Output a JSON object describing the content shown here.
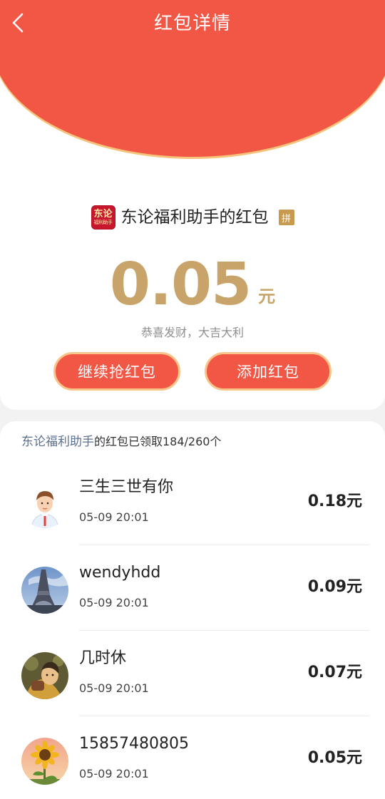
{
  "header": {
    "title": "红包详情",
    "back_icon": "chevron-left-icon"
  },
  "packet": {
    "logo_text_top": "东论",
    "logo_text_bottom": "福利助手",
    "sender_title": "东论福利助手的红包",
    "pin_badge": "拼",
    "amount": "0.05",
    "unit": "元",
    "blessing": "恭喜发财，大吉大利"
  },
  "actions": {
    "continue_label": "继续抢红包",
    "add_label": "添加红包"
  },
  "summary": {
    "sender": "东论福利助手",
    "text": "的红包已领取184/260个"
  },
  "claims": [
    {
      "name": "三生三世有你",
      "time": "05-09 20:01",
      "amount": "0.18元",
      "avatar": "cartoon-man-avatar"
    },
    {
      "name": "wendyhdd",
      "time": "05-09 20:01",
      "amount": "0.09元",
      "avatar": "eiffel-tower-avatar"
    },
    {
      "name": "几时休",
      "time": "05-09 20:01",
      "amount": "0.07元",
      "avatar": "character-avatar"
    },
    {
      "name": "15857480805",
      "time": "05-09 20:01",
      "amount": "0.05元",
      "avatar": "sunflower-avatar"
    }
  ],
  "colors": {
    "header_red": "#f25746",
    "gold": "#c8a46a",
    "link_blue": "#5b6f93"
  }
}
